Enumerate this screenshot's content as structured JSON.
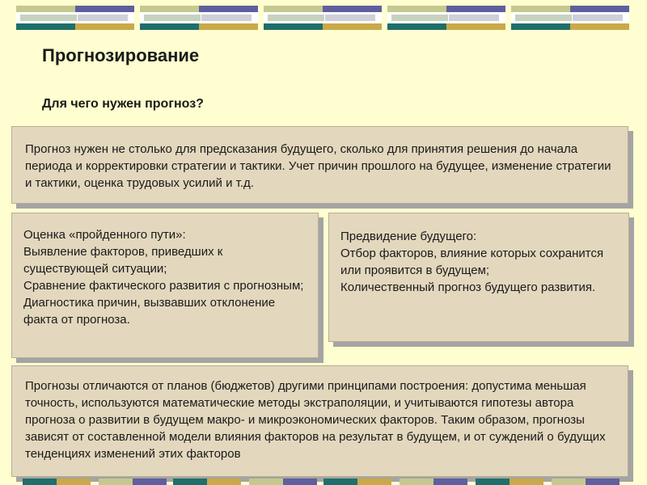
{
  "header": {
    "title": "Прогнозирование",
    "subtitle": "Для чего нужен прогноз?"
  },
  "boxes": {
    "top": "Прогноз нужен не столько для предсказания будущего, сколько для принятия решения до начала периода и корректировки стратегии и тактики. Учет причин прошлого на будущее, изменение стратегии и тактики, оценка трудовых усилий и т.д.",
    "left": "Оценка «пройденного пути»:\nВыявление факторов, приведших к существующей ситуации;\nСравнение фактического развития с прогнозным;\nДиагностика причин, вызвавших отклонение факта от прогноза.",
    "right": "Предвидение будущего:\nОтбор факторов, влияние которых сохранится или проявится в будущем;\nКоличественный прогноз будущего развития.",
    "bottom": "Прогнозы отличаются от планов (бюджетов) другими принципами построения: допустима меньшая точность, используются математические методы экстраполяции, и учитываются гипотезы автора прогноза о развитии в будущем макро- и микроэкономических факторов. Таким образом, прогнозы зависят от составленной модели влияния факторов на результат в будущем, и от суждений о будущих тенденциях изменений этих факторов"
  },
  "colors": {
    "background": "#fffed0",
    "box_fill": "#e3d7bd",
    "box_shadow": "#a4a4a4",
    "teal": "#1f6f6a",
    "gold": "#c9a94a",
    "purple": "#5f5f9e",
    "olive": "#c5c98f"
  }
}
